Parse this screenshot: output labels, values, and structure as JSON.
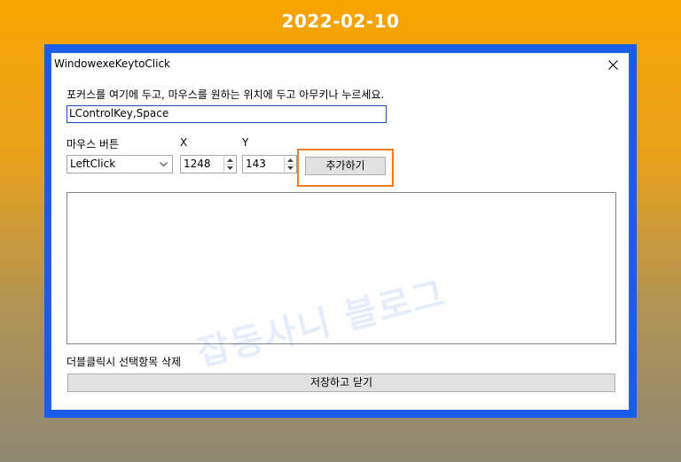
{
  "caption": {
    "date": "2022-02-10"
  },
  "window": {
    "title": "WindowexeKeytoClick",
    "instruction": "포커스를 여기에 두고, 마우스를 원하는 위치에 두고 아무키나 누르세요.",
    "key_input_value": "LControlKey,Space",
    "mouse_button_label": "마우스 버튼",
    "x_label": "X",
    "y_label": "Y",
    "mouse_button_selected": "LeftClick",
    "x_value": "1248",
    "y_value": "143",
    "add_button": "추가하기",
    "hint": "더블클릭시 선택항목 삭제",
    "save_close_button": "저장하고 닫기"
  },
  "watermark": "잡동사니 블로그",
  "colors": {
    "highlight": "#f07d1c",
    "desktop_blue": "#1a5ee8"
  },
  "icons": [
    "close-icon",
    "chevron-down-icon",
    "spin-up-icon",
    "spin-down-icon"
  ]
}
